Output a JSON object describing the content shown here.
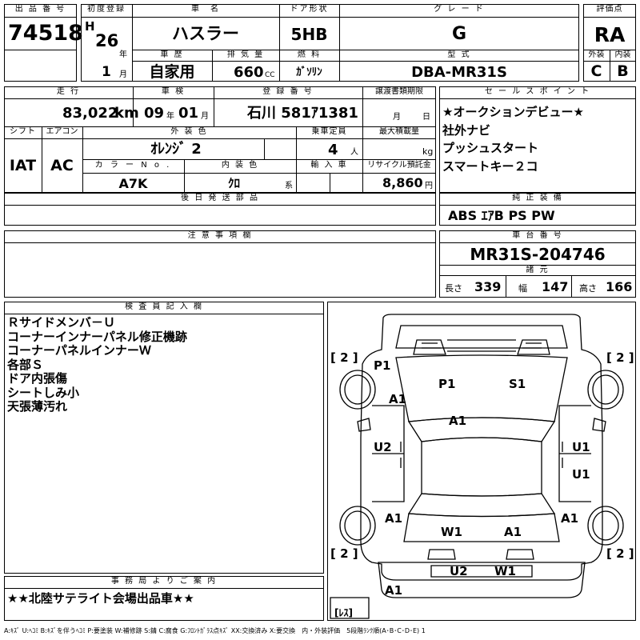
{
  "labels": {
    "lot_no": "出 品 番 号",
    "first_reg": "初度登録",
    "car_name": "車　名",
    "door": "ドア形状",
    "grade": "グ レ ー ド",
    "score": "評価点",
    "history": "車 歴",
    "displacement": "排 気 量",
    "fuel": "燃 料",
    "model": "型 式",
    "exterior": "外装",
    "interior": "内装",
    "mileage": "走 行",
    "inspection": "車 検",
    "plate": "登 録 番 号",
    "transfer_docs": "譲渡書類期限",
    "sales_points": "セ ー ル ス ポ イ ン ト",
    "shift": "シフト",
    "aircon": "エアコン",
    "ext_color": "外 装 色",
    "capacity": "乗車定員",
    "max_load": "最大積載量",
    "color_no": "カ ラ ー N o .",
    "int_color": "内 装 色",
    "import": "輸 入 車",
    "recycle": "リサイクル預託金",
    "later_parts": "後 日 発 送 部 品",
    "equipment": "純 正 装 備",
    "caution": "注 意 事 項 欄",
    "chassis": "車 台 番 号",
    "specs": "諸 元",
    "inspector": "検 査 員 記 入 欄",
    "office_notice": "事 務 局 よ り ご 案 内"
  },
  "values": {
    "lot_no": "74518",
    "era": "H",
    "reg_year": "26",
    "year_unit": "年",
    "reg_month": "1",
    "month_unit": "月",
    "car_name": "ハスラー",
    "door": "5HB",
    "grade": "G",
    "score": "RA",
    "history": "自家用",
    "displacement": "660",
    "displacement_unit": "CC",
    "fuel": "ｶﾞｿﾘﾝ",
    "model": "DBA-MR31S",
    "exterior": "C",
    "interior": "B",
    "mileage": "83,022",
    "mileage_unit": "km",
    "insp_year": "09",
    "insp_year_unit": "年",
    "insp_month": "01",
    "insp_month_unit": "月",
    "plate": "石川 581ｱ1381",
    "transfer_month_unit": "月",
    "transfer_day_unit": "日",
    "shift": "IAT",
    "aircon": "AC",
    "ext_color": "ｵﾚﾝｼﾞ 2",
    "capacity": "4",
    "capacity_unit": "人",
    "max_load_unit": "kg",
    "color_no": "A7K",
    "int_color": "ｸﾛ",
    "int_color_unit": "系",
    "recycle": "8,860",
    "recycle_unit": "円",
    "equipment": "ABS ｴｱB PS PW",
    "chassis": "MR31S-204746",
    "length_label": "長さ",
    "length": "339",
    "width_label": "幅",
    "width": "147",
    "height_label": "高さ",
    "height": "166"
  },
  "sales_points": [
    "★オークションデビュー★",
    "社外ナビ",
    "プッシュスタート",
    "スマートキー２コ"
  ],
  "inspector_notes": [
    "Ｒサイドメンバ－Ｕ",
    "コーナーインナーパネル修正機跡",
    "コーナーパネルインナーＷ",
    "各部Ｓ",
    "ドア内張傷",
    "シートしみ小",
    "天張薄汚れ"
  ],
  "office_notice": "★★北陸サテライト会場出品車★★",
  "diagram": {
    "tire_tl": "[ 2 ]",
    "tire_tr": "[ 2 ]",
    "tire_bl": "[ 2 ]",
    "tire_br": "[ 2 ]",
    "spare": "[ﾚｽ]",
    "marks": {
      "front_p1": "P1",
      "hood_p1": "P1",
      "hood_s1": "S1",
      "fender_a1": "A1",
      "cowl_a1": "A1",
      "door_u2": "U2",
      "door_u1_front": "U1",
      "door_u1_rear": "U1",
      "rear_a1_left": "A1",
      "rear_a1_right": "A1",
      "glass_w1_left": "W1",
      "glass_a1_right": "A1",
      "tail_u2": "U2",
      "tail_w1": "W1",
      "bumper_a1": "A1"
    }
  },
  "legend": "A:ｷｽﾞ U:ﾍｺﾐ B:ｷｽﾞを伴うﾍｺﾐ P:要塗装 W:補修跡 S:錆 C:腐食 G:ﾌﾛﾝﾄｶﾞﾗｽ点ｷｽﾞ XX:交換済み X:要交換　内・外装評価　5段階ﾗﾝｸ順(A･B･C･D･E) 1"
}
